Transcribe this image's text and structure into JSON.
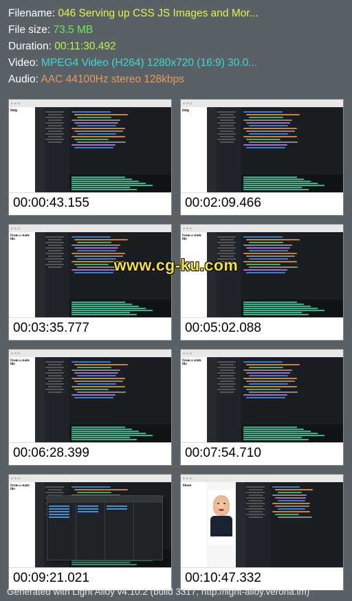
{
  "meta": {
    "filename_label": "Filename:",
    "filename": "046 Serving up CSS JS Images and Mor...",
    "filesize_label": "File size:",
    "filesize": "73.5 MB",
    "duration_label": "Duration:",
    "duration": "00:11:30.492",
    "video_label": "Video:",
    "video": "MPEG4 Video (H264) 1280x720 (16:9) 30.0...",
    "audio_label": "Audio:",
    "audio": "AAC 44100Hz stereo 128kbps"
  },
  "thumbs": [
    {
      "ts": "00:00:43.155",
      "side": "Help"
    },
    {
      "ts": "00:02:09.466",
      "side": "Help"
    },
    {
      "ts": "00:03:35.777",
      "side": "From a static file"
    },
    {
      "ts": "00:05:02.088",
      "side": "From a static file"
    },
    {
      "ts": "00:06:28.399",
      "side": "From a static file"
    },
    {
      "ts": "00:07:54.710",
      "side": "From a static file"
    },
    {
      "ts": "00:09:21.021",
      "side": "From a static file",
      "popup": true
    },
    {
      "ts": "00:10:47.332",
      "side": "About",
      "face": true
    }
  ],
  "watermark": "www.cg-ku.com",
  "footer": "Generated with Light Alloy v4.10.2 (build 3317, http://light-alloy.verona.im)"
}
